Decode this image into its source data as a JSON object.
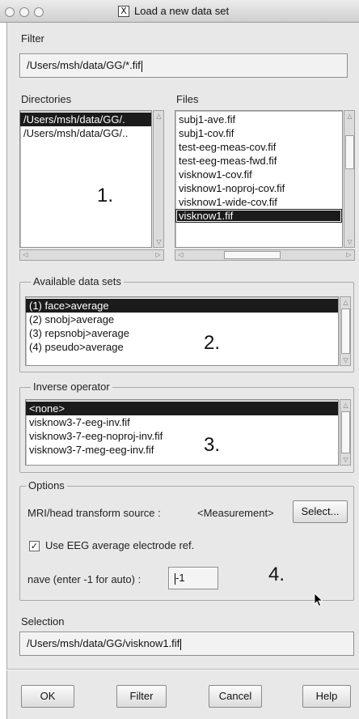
{
  "window": {
    "title": "Load a new data set",
    "title_icon": "x11-icon"
  },
  "filter": {
    "label": "Filter",
    "value": "/Users/msh/data/GG/*.fif"
  },
  "directories": {
    "label": "Directories",
    "items": [
      "/Users/msh/data/GG/.",
      "/Users/msh/data/GG/.."
    ],
    "selected_index": 0
  },
  "files": {
    "label": "Files",
    "items": [
      "subj1-ave.fif",
      "subj1-cov.fif",
      "test-eeg-meas-cov.fif",
      "test-eeg-meas-fwd.fif",
      "visknow1-cov.fif",
      "visknow1-noproj-cov.fif",
      "visknow1-wide-cov.fif",
      "visknow1.fif"
    ],
    "selected_index": 7
  },
  "datasets": {
    "label": "Available data sets",
    "items": [
      "(1) face>average",
      "(2) snobj>average",
      "(3) repsnobj>average",
      "(4) pseudo>average"
    ],
    "selected_index": 0
  },
  "inverse": {
    "label": "Inverse operator",
    "items": [
      "<none>",
      "visknow3-7-eeg-inv.fif",
      "visknow3-7-eeg-noproj-inv.fif",
      "visknow3-7-meg-eeg-inv.fif"
    ],
    "selected_index": 0
  },
  "options": {
    "label": "Options",
    "mri_label": "MRI/head transform source :",
    "mri_value": "<Measurement>",
    "select_label": "Select...",
    "eeg_label": "Use EEG average electrode ref.",
    "eeg_checked": true,
    "nave_label": "nave (enter -1 for auto) :",
    "nave_value": "-1"
  },
  "selection": {
    "label": "Selection",
    "value": "/Users/msh/data/GG/visknow1.fif"
  },
  "annotations": {
    "n1": "1.",
    "n2": "2.",
    "n3": "3.",
    "n4": "4."
  },
  "buttons": {
    "ok": "OK",
    "filter": "Filter",
    "cancel": "Cancel",
    "help": "Help"
  }
}
